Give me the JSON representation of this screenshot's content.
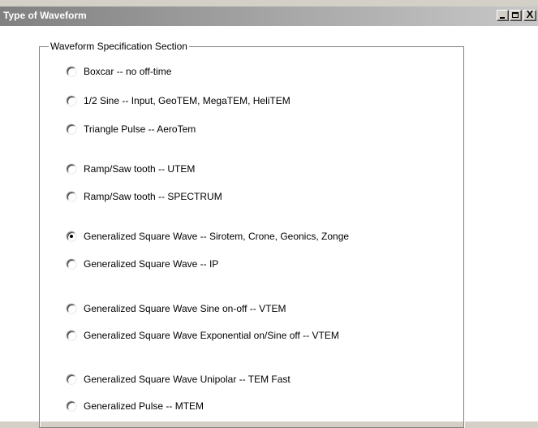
{
  "window": {
    "title": "Type of Waveform",
    "controls": {
      "minimize_icon": "minimize-icon",
      "maximize_icon": "maximize-icon",
      "close_icon": "close-icon",
      "close_glyph": "X"
    }
  },
  "group": {
    "legend": "Waveform Specification Section",
    "options": [
      {
        "label": "Boxcar -- no off-time",
        "selected": false
      },
      {
        "label": "1/2 Sine -- Input, GeoTEM, MegaTEM, HeliTEM",
        "selected": false
      },
      {
        "label": "Triangle Pulse -- AeroTem",
        "selected": false
      },
      {
        "label": "Ramp/Saw tooth -- UTEM",
        "selected": false
      },
      {
        "label": "Ramp/Saw tooth -- SPECTRUM",
        "selected": false
      },
      {
        "label": "Generalized Square Wave -- Sirotem, Crone, Geonics, Zonge",
        "selected": true
      },
      {
        "label": "Generalized Square Wave -- IP",
        "selected": false
      },
      {
        "label": "Generalized Square Wave Sine on-off -- VTEM",
        "selected": false
      },
      {
        "label": "Generalized Square Wave Exponential on/Sine off -- VTEM",
        "selected": false
      },
      {
        "label": "Generalized Square Wave Unipolar -- TEM Fast",
        "selected": false
      },
      {
        "label": "Generalized Pulse -- MTEM",
        "selected": false
      }
    ]
  }
}
